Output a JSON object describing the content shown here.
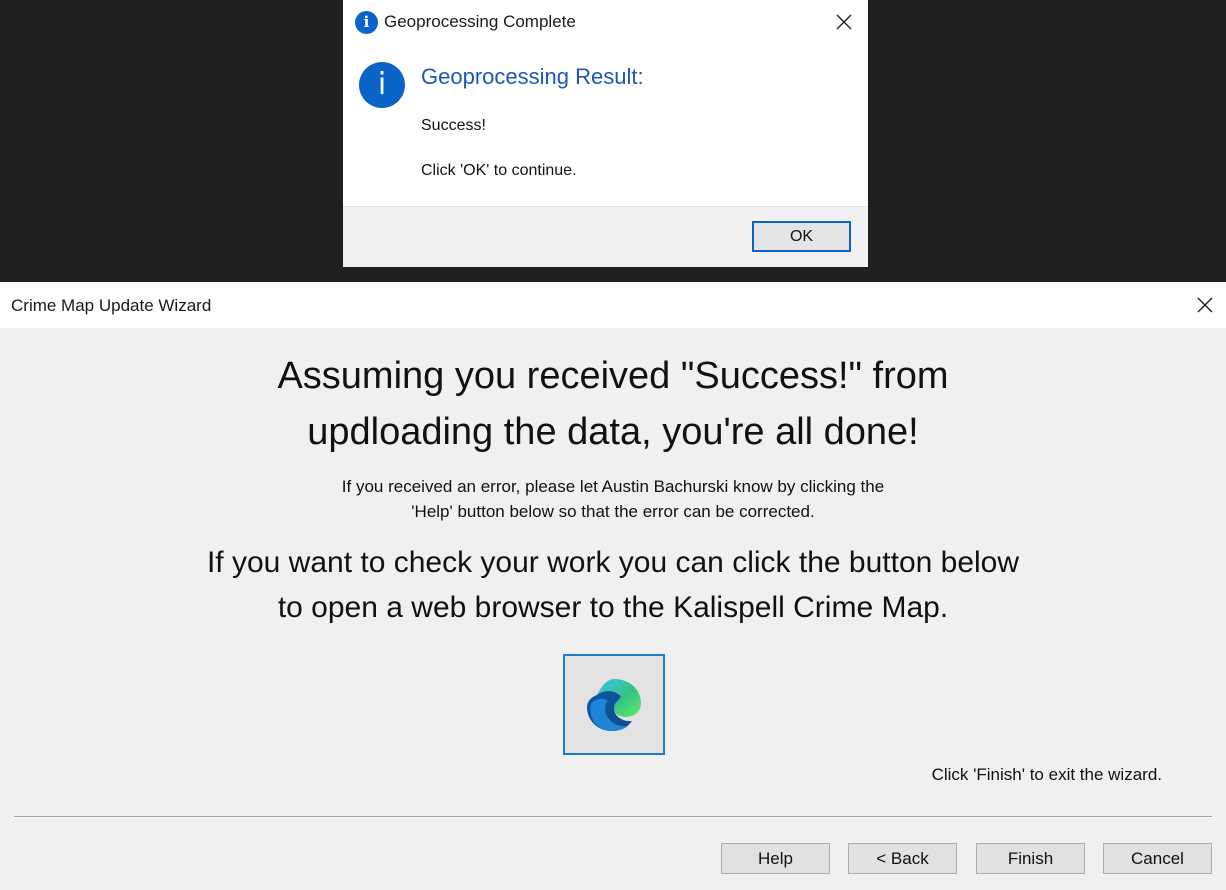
{
  "message_box": {
    "title": "Geoprocessing Complete",
    "title_icon": "info-icon",
    "heading": "Geoprocessing Result:",
    "body_line1": "Success!",
    "body_line2": "Click 'OK' to continue.",
    "ok_label": "OK",
    "accent_color": "#0a64c8"
  },
  "wizard": {
    "title": "Crime Map Update Wizard",
    "headline_line1": "Assuming you received \"Success!\" from",
    "headline_line2": "updloading the data, you're all done!",
    "note_line1": "If you received an error, please let Austin Bachurski know by clicking the",
    "note_line2": "'Help' button below so that the error can be corrected.",
    "check_line1": "If you want to check your work you can click the button below",
    "check_line2": "to open a web browser to the Kalispell Crime Map.",
    "browser_button_icon": "edge-browser-icon",
    "finish_hint": "Click 'Finish' to exit the wizard.",
    "buttons": {
      "help": "Help",
      "back": "< Back",
      "finish": "Finish",
      "cancel": "Cancel"
    }
  }
}
